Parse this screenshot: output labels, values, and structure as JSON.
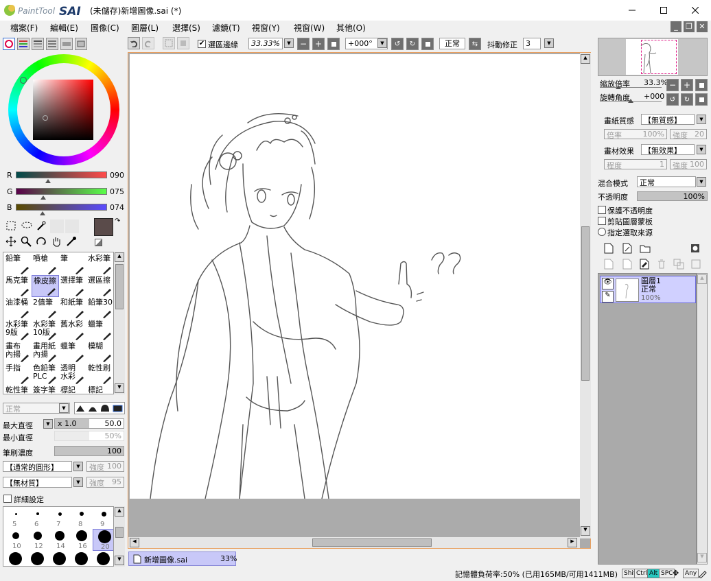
{
  "window": {
    "app_name": "PaintTool SAI",
    "title": "(未儲存)新增圖像.sai (*)"
  },
  "menu": [
    "檔案(F)",
    "編輯(E)",
    "圖像(C)",
    "圖層(L)",
    "選擇(S)",
    "濾鏡(T)",
    "視窗(Y)",
    "視窗(W)",
    "其他(O)"
  ],
  "toolbar": {
    "selection_edge_label": "選區邊緣",
    "selection_edge_checked": true,
    "zoom": "33.33%",
    "rotation": "+000°",
    "blend_mode": "正常",
    "stabilizer_label": "抖動修正",
    "stabilizer": "3"
  },
  "color": {
    "r_label": "R",
    "r_value": "090",
    "g_label": "G",
    "g_value": "075",
    "b_label": "B",
    "b_value": "074",
    "main_color": "#5a4b4a"
  },
  "brushes": [
    [
      "鉛筆",
      "噴槍",
      "筆",
      "水彩筆"
    ],
    [
      "馬克筆",
      "橡皮擦",
      "選擇筆",
      "選區擦"
    ],
    [
      "油漆桶",
      "2值筆",
      "和紙筆",
      "鉛筆30"
    ],
    [
      "水彩筆 9版",
      "水彩筆 10版",
      "舊水彩",
      "蠟筆"
    ],
    [
      "畫布 內揚",
      "畫用紙 內揚",
      "蠟筆",
      "模糊"
    ],
    [
      "手指",
      "色鉛筆 PLC",
      "透明 水彩",
      "乾性刷"
    ],
    [
      "乾性筆",
      "簽字筆",
      "標記",
      "標記"
    ]
  ],
  "brush_settings": {
    "mode": "正常",
    "max_size_label": "最大直徑",
    "multiplier": "x 1.0",
    "max_size": "50.0",
    "min_size_label": "最小直徑",
    "min_size": "50%",
    "density_label": "筆刷濃度",
    "density": "100",
    "shape": "【通常的圓形】",
    "shape_strength_label": "強度",
    "shape_strength": "100",
    "texture": "【無材質】",
    "texture_strength_label": "強度",
    "texture_strength": "95",
    "detail_label": "詳細設定"
  },
  "dot_sizes": [
    "5",
    "6",
    "7",
    "8",
    "9",
    "10",
    "12",
    "14",
    "16",
    "20"
  ],
  "navigator": {
    "zoom_label": "縮放倍率",
    "zoom": "33.3%",
    "angle_label": "旋轉角度",
    "angle": "+000"
  },
  "paper": {
    "texture_label": "畫紙質感",
    "texture": "【無質感】",
    "scale_label": "倍率",
    "scale": "100%",
    "strength_label": "強度",
    "strength": "20",
    "effect_label": "畫材效果",
    "effect": "【無效果】",
    "degree_label": "程度",
    "degree": "1",
    "effect_strength_label": "強度",
    "effect_strength": "100"
  },
  "layer_props": {
    "blend_label": "混合模式",
    "blend": "正常",
    "opacity_label": "不透明度",
    "opacity": "100%",
    "preserve_label": "保護不透明度",
    "clip_label": "剪貼圖層蒙板",
    "source_label": "指定選取來源"
  },
  "layers": [
    {
      "name": "圖層1",
      "mode": "正常",
      "opacity": "100%"
    }
  ],
  "tabs": [
    {
      "name": "新增圖像.sai",
      "zoom": "33%"
    }
  ],
  "status": {
    "memory": "記憶體負荷率:50% (已用165MB/可用1411MB)",
    "keys": [
      "Shift",
      "Ctrl",
      "Alt",
      "SPC",
      "Any"
    ]
  }
}
